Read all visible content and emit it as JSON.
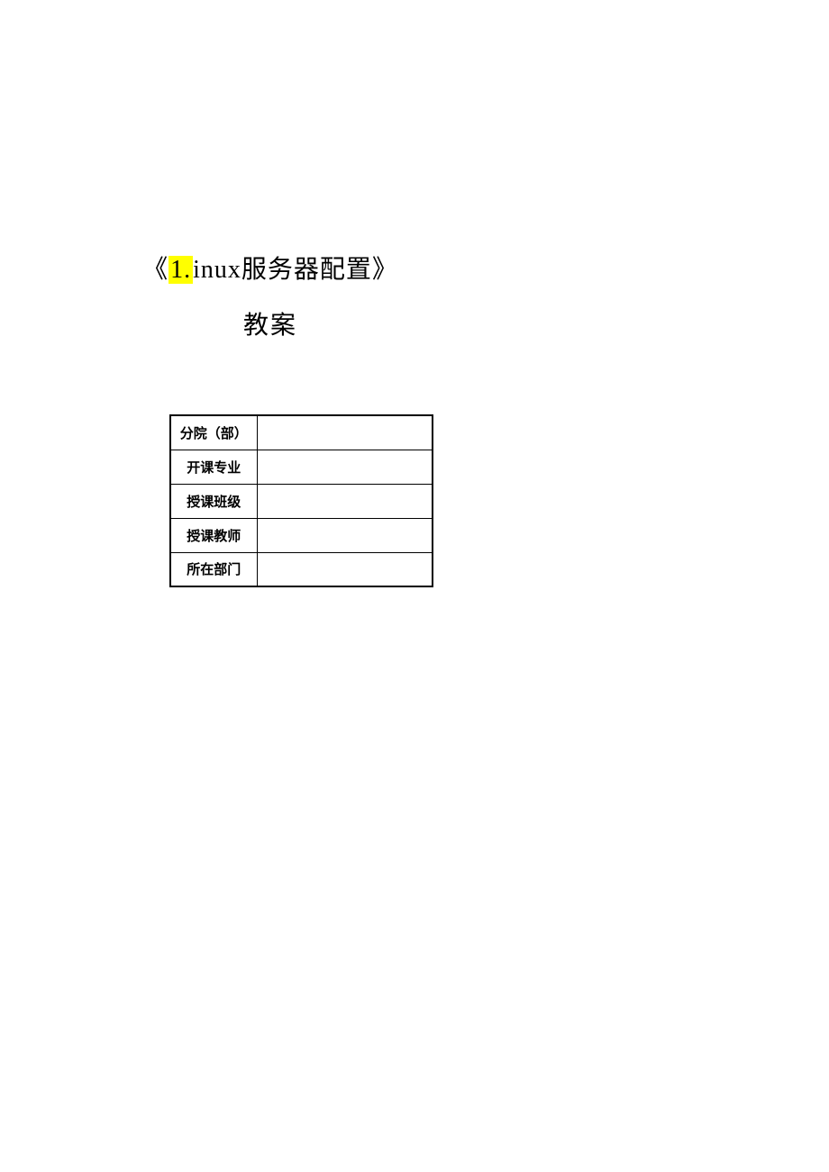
{
  "title": {
    "prefix": "《",
    "highlight": "1.",
    "rest": "inux服务器配置》",
    "line2": "教案"
  },
  "table": {
    "rows": [
      {
        "label": "分院（部）",
        "value": ""
      },
      {
        "label": "开课专业",
        "value": ""
      },
      {
        "label": "授课班级",
        "value": ""
      },
      {
        "label": "授课教师",
        "value": ""
      },
      {
        "label": "所在部门",
        "value": ""
      }
    ]
  }
}
